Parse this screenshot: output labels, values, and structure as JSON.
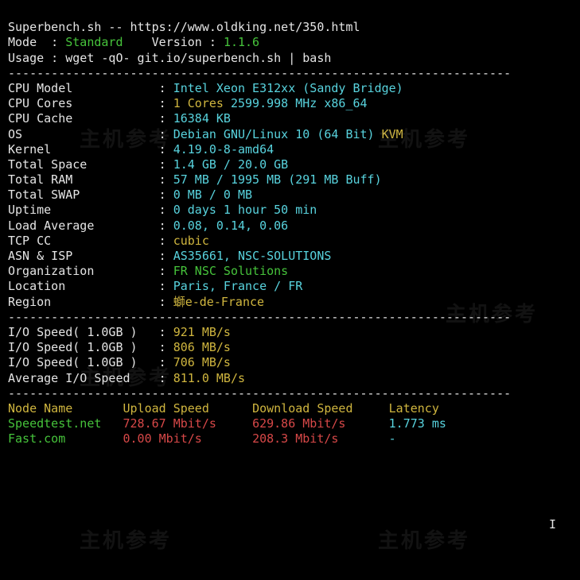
{
  "header": {
    "line1": "Superbench.sh -- https://www.oldking.net/350.html",
    "mode_label": "Mode",
    "mode_value": "Standard",
    "version_label": "Version",
    "version_value": "1.1.6",
    "usage": "Usage : wget -qO- git.io/superbench.sh | bash"
  },
  "hr": "----------------------------------------------------------------------",
  "sys": {
    "labels": {
      "cpu_model": "CPU Model",
      "cpu_cores": "CPU Cores",
      "cpu_cache": "CPU Cache",
      "os": "OS",
      "kernel": "Kernel",
      "total_space": "Total Space",
      "total_ram": "Total RAM",
      "total_swap": "Total SWAP",
      "uptime": "Uptime",
      "load": "Load Average",
      "tcp": "TCP CC",
      "asn": "ASN & ISP",
      "org": "Organization",
      "loc": "Location",
      "reg": "Region"
    },
    "cpu_model": "Intel Xeon E312xx (Sandy Bridge)",
    "cpu_cores_n": "1 Cores",
    "cpu_cores_rest": " 2599.998 MHz x86_64",
    "cpu_cache": "16384 KB",
    "os_val": "Debian GNU/Linux 10 (64 Bit)",
    "os_virt": " KVM",
    "kernel": "4.19.0-8-amd64",
    "space": "1.4 GB / 20.0 GB",
    "ram": "57 MB / 1995 MB (291 MB Buff)",
    "swap": "0 MB / 0 MB",
    "uptime": "0 days 1 hour 50 min",
    "load": "0.08, 0.14, 0.06",
    "tcp": "cubic",
    "asn": "AS35661, NSC-SOLUTIONS",
    "org": "FR NSC Solutions",
    "loc": "Paris, France / FR",
    "reg": "螄e-de-France"
  },
  "io": {
    "label1": "I/O Speed( 1.0GB )",
    "label2": "I/O Speed( 1.0GB )",
    "label3": "I/O Speed( 1.0GB )",
    "label_avg": "Average I/O Speed",
    "v1": "921 MB/s",
    "v2": "806 MB/s",
    "v3": "706 MB/s",
    "avg": "811.0 MB/s"
  },
  "speed": {
    "h_node": "Node Name",
    "h_up": "Upload Speed",
    "h_dn": "Download Speed",
    "h_lat": "Latency",
    "rows": {
      "0": {
        "name": "Speedtest.net",
        "up": "728.67 Mbit/s",
        "dn": "629.86 Mbit/s",
        "lat": "1.773 ms"
      },
      "1": {
        "name": "Fast.com",
        "up": "0.00 Mbit/s",
        "dn": "208.3 Mbit/s",
        "lat": "-"
      }
    }
  },
  "watermark": "主机参考"
}
